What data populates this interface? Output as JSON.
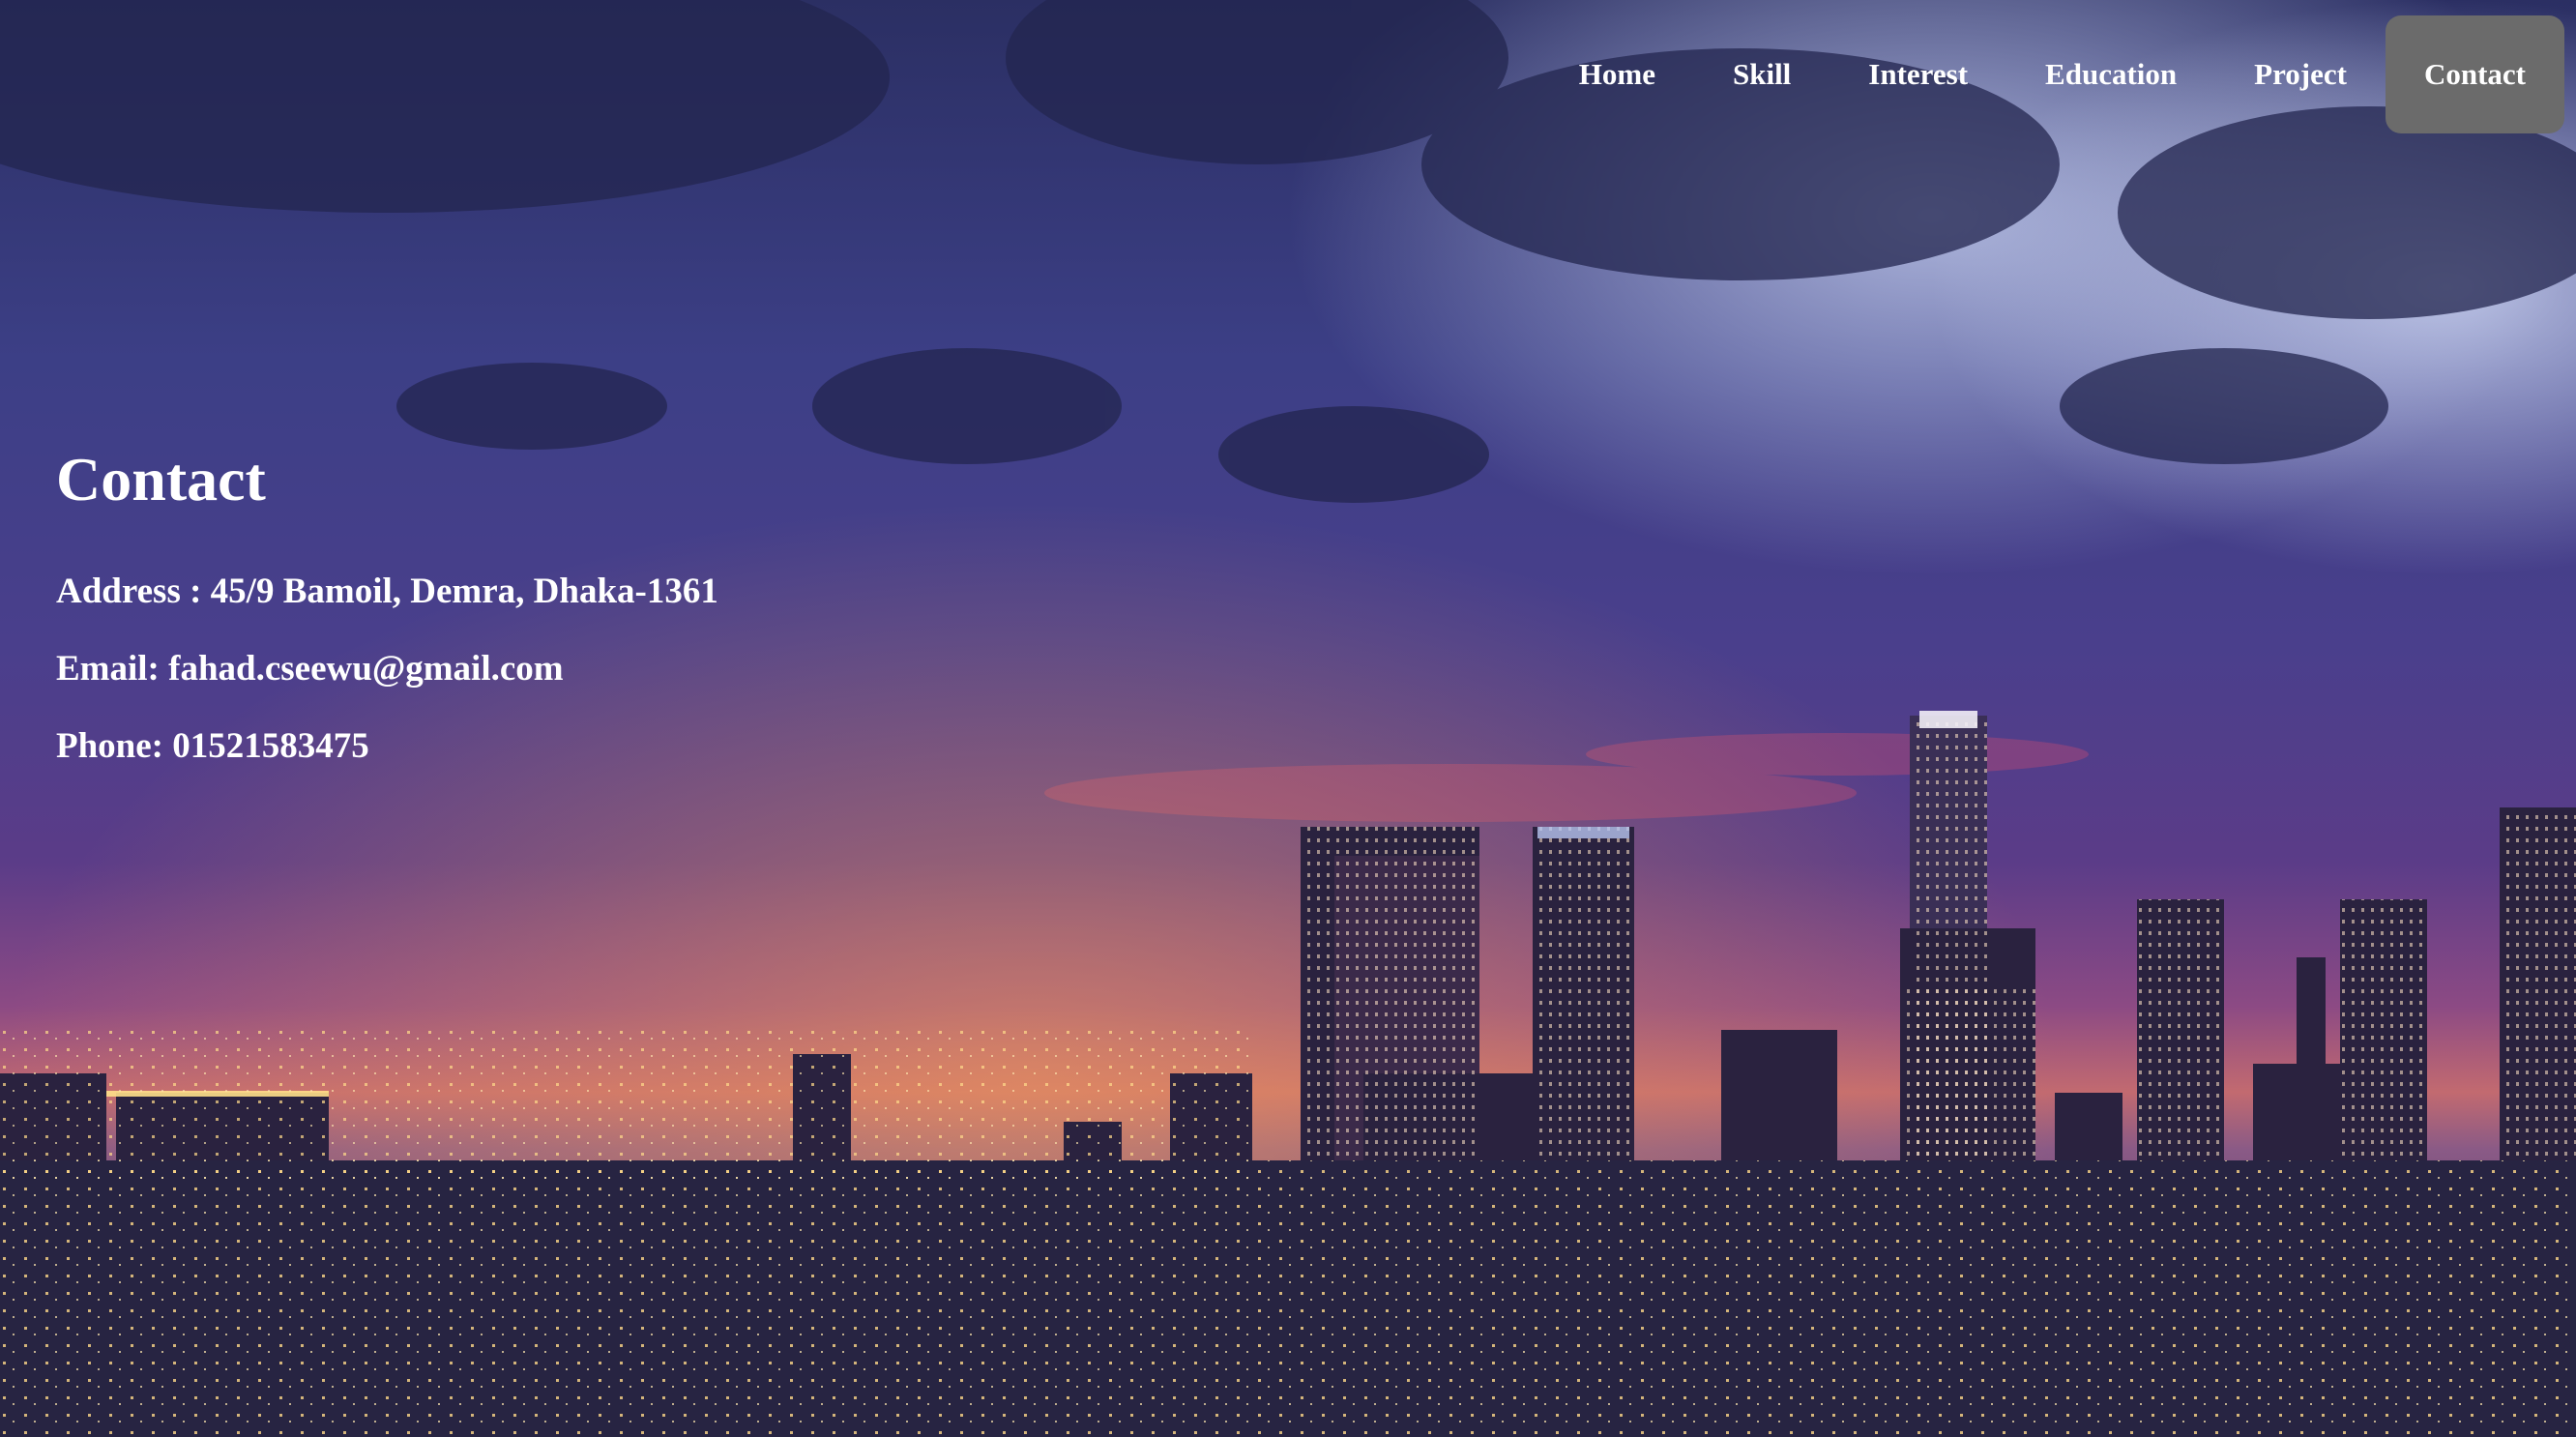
{
  "nav": {
    "items": [
      {
        "label": "Home",
        "active": false
      },
      {
        "label": "Skill",
        "active": false
      },
      {
        "label": "Interest",
        "active": false
      },
      {
        "label": "Education",
        "active": false
      },
      {
        "label": "Project",
        "active": false
      },
      {
        "label": "Contact",
        "active": true
      }
    ]
  },
  "contact": {
    "title": "Contact",
    "address": "Address : 45/9 Bamoil, Demra, Dhaka-1361",
    "email": "Email: fahad.cseewu@gmail.com",
    "phone": "Phone: 01521583475"
  },
  "colors": {
    "active_nav_bg": "#6b6b6b",
    "text": "#ffffff"
  }
}
